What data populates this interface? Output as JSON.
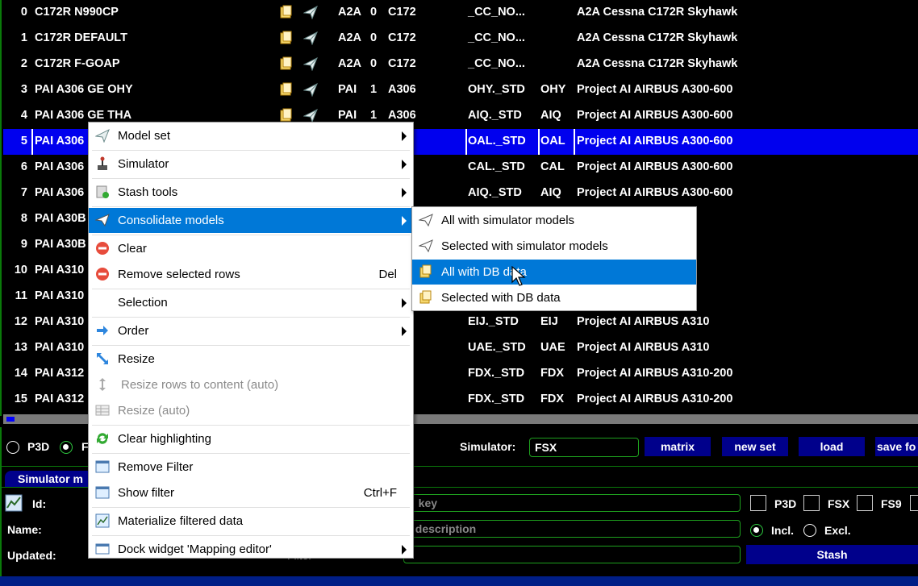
{
  "table": {
    "rows": [
      {
        "idx": "0",
        "model": "C172R N990CP",
        "a": "A2A",
        "b": "0",
        "c": "C172",
        "d": "_CC_NO...",
        "e": "",
        "f": "A2A Cessna C172R Skyhawk"
      },
      {
        "idx": "1",
        "model": "C172R DEFAULT",
        "a": "A2A",
        "b": "0",
        "c": "C172",
        "d": "_CC_NO...",
        "e": "",
        "f": "A2A Cessna C172R Skyhawk"
      },
      {
        "idx": "2",
        "model": "C172R F-GOAP",
        "a": "A2A",
        "b": "0",
        "c": "C172",
        "d": "_CC_NO...",
        "e": "",
        "f": "A2A Cessna C172R Skyhawk"
      },
      {
        "idx": "3",
        "model": "PAI A306 GE OHY",
        "a": "PAI",
        "b": "1",
        "c": "A306",
        "d": "OHY._STD",
        "e": "OHY",
        "f": "Project AI AIRBUS A300-600"
      },
      {
        "idx": "4",
        "model": "PAI A306 GE THA",
        "a": "PAI",
        "b": "1",
        "c": "A306",
        "d": "AIQ._STD",
        "e": "AIQ",
        "f": "Project AI AIRBUS A300-600"
      },
      {
        "idx": "5",
        "model": "PAI A306",
        "a": "",
        "b": "",
        "c": "6",
        "d": "OAL._STD",
        "e": "OAL",
        "f": "Project AI AIRBUS A300-600"
      },
      {
        "idx": "6",
        "model": "PAI A306",
        "a": "",
        "b": "",
        "c": "6",
        "d": "CAL._STD",
        "e": "CAL",
        "f": "Project AI AIRBUS A300-600"
      },
      {
        "idx": "7",
        "model": "PAI A306",
        "a": "",
        "b": "",
        "c": "6",
        "d": "AIQ._STD",
        "e": "AIQ",
        "f": "Project AI AIRBUS A300-600"
      },
      {
        "idx": "8",
        "model": "PAI A30B",
        "a": "",
        "b": "",
        "c": "",
        "d": "",
        "e": "",
        "f": "300-200"
      },
      {
        "idx": "9",
        "model": "PAI A30B",
        "a": "",
        "b": "",
        "c": "",
        "d": "",
        "e": "",
        "f": "300-200"
      },
      {
        "idx": "10",
        "model": "PAI A310",
        "a": "",
        "b": "",
        "c": "",
        "d": "",
        "e": "",
        "f": "310"
      },
      {
        "idx": "11",
        "model": "PAI A310",
        "a": "",
        "b": "",
        "c": "",
        "d": "",
        "e": "",
        "f": "310"
      },
      {
        "idx": "12",
        "model": "PAI A310",
        "a": "",
        "b": "",
        "c": "0",
        "d": "EIJ._STD",
        "e": "EIJ",
        "f": "Project AI AIRBUS A310"
      },
      {
        "idx": "13",
        "model": "PAI A310",
        "a": "",
        "b": "",
        "c": "0",
        "d": "UAE._STD",
        "e": "UAE",
        "f": "Project AI AIRBUS A310"
      },
      {
        "idx": "14",
        "model": "PAI A312",
        "a": "",
        "b": "",
        "c": "0",
        "d": "FDX._STD",
        "e": "FDX",
        "f": "Project AI AIRBUS A310-200"
      },
      {
        "idx": "15",
        "model": "PAI A312",
        "a": "",
        "b": "",
        "c": "0",
        "d": "FDX._STD",
        "e": "FDX",
        "f": "Project AI AIRBUS A310-200"
      }
    ]
  },
  "controls": {
    "p3d_label": "P3D",
    "f_label": "F",
    "simulator_label": "Simulator:",
    "simulator_value": "FSX",
    "matrix": "matrix",
    "new_set": "new set",
    "load": "load",
    "save": "save fo",
    "tab": "Simulator m",
    "id_label": "Id:",
    "name_label": "Name:",
    "updated_label": "Updated:",
    "key_placeholder": "l  key",
    "desc_placeholder": "l description",
    "filter_label": "Filter",
    "chk_p3d": "P3D",
    "chk_fsx": "FSX",
    "chk_fs9": "FS9",
    "incl": "Incl.",
    "excl": "Excl.",
    "stash": "Stash"
  },
  "context_menu": {
    "items": [
      {
        "label": "Model set",
        "shortcut": "",
        "sub": true,
        "icon": "plane-icon"
      },
      {
        "label": "Simulator",
        "shortcut": "",
        "sub": true,
        "icon": "joystick-icon"
      },
      {
        "label": "Stash tools",
        "shortcut": "",
        "sub": true,
        "icon": "stash-icon"
      },
      {
        "label": "Consolidate models",
        "shortcut": "",
        "sub": true,
        "icon": "paper-plane-icon"
      },
      {
        "label": "Clear",
        "shortcut": "",
        "sub": false,
        "icon": "remove-icon"
      },
      {
        "label": "Remove selected rows",
        "shortcut": "Del",
        "sub": false,
        "icon": "remove-icon"
      },
      {
        "label": "Selection",
        "shortcut": "",
        "sub": true,
        "icon": ""
      },
      {
        "label": "Order",
        "shortcut": "",
        "sub": true,
        "icon": "arrow-right-icon"
      },
      {
        "label": "Resize",
        "shortcut": "",
        "sub": false,
        "icon": "resize-icon"
      },
      {
        "label": "Resize rows to content (auto)",
        "shortcut": "",
        "sub": false,
        "icon": "resize-vertical-icon"
      },
      {
        "label": "Resize (auto)",
        "shortcut": "",
        "sub": false,
        "icon": "grid-icon"
      },
      {
        "label": "Clear highlighting",
        "shortcut": "",
        "sub": false,
        "icon": "refresh-icon"
      },
      {
        "label": "Remove Filter",
        "shortcut": "",
        "sub": false,
        "icon": "filter-window-icon"
      },
      {
        "label": "Show filter",
        "shortcut": "Ctrl+F",
        "sub": false,
        "icon": "filter-window-icon"
      },
      {
        "label": "Materialize filtered data",
        "shortcut": "",
        "sub": false,
        "icon": "chart-icon"
      },
      {
        "label": "Dock widget 'Mapping editor'",
        "shortcut": "",
        "sub": true,
        "icon": "window-icon"
      }
    ]
  },
  "submenu": {
    "items": [
      {
        "label": "All with simulator models",
        "icon": "paper-plane-icon"
      },
      {
        "label": "Selected with simulator models",
        "icon": "paper-plane-icon"
      },
      {
        "label": "All with DB data",
        "icon": "database-icon"
      },
      {
        "label": "Selected with DB data",
        "icon": "database-icon"
      }
    ]
  },
  "colors": {
    "selected_row": "#0000ee",
    "menu_highlight": "#0078d7",
    "button_bg": "#00008b",
    "field_border": "#1ea01e"
  }
}
